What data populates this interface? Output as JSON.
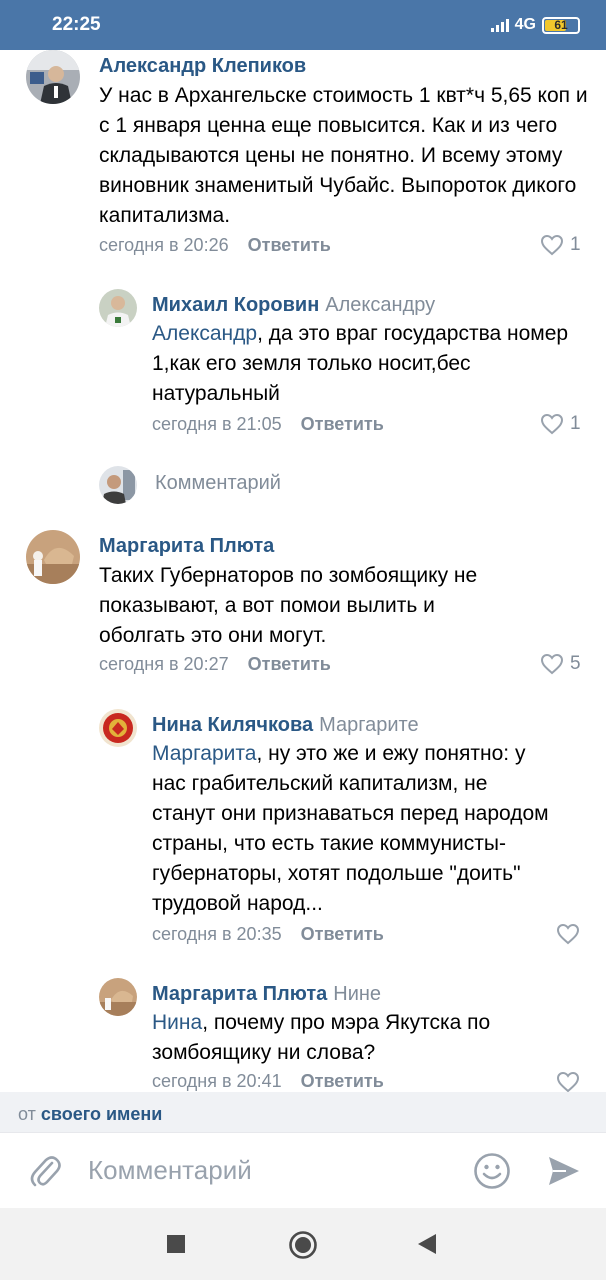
{
  "status_bar": {
    "time": "22:25",
    "network": "4G",
    "battery": "61",
    "battery_level": 0.61
  },
  "comments": [
    {
      "author": "Александр Клепиков",
      "reply_to": "",
      "mention": "",
      "text": "У нас в Архангельске стоимость 1 квт*ч 5,65 коп и с 1 января ценна еще повысится. Как и из чего складываются цены не понятно. И всему этому виновник знаменитый Чубайс. Выпороток дикого капитализма.",
      "date": "сегодня в 20:26",
      "reply_label": "Ответить",
      "likes": "1"
    },
    {
      "author": "Михаил Коровин",
      "reply_to": "Александру",
      "mention": "Александр",
      "text": ", да это враг государства номер 1,как его земля только носит,бес натуральный",
      "date": "сегодня в 21:05",
      "reply_label": "Ответить",
      "likes": "1"
    },
    {
      "author": "Маргарита Плюта",
      "reply_to": "",
      "mention": "",
      "text": "Таких Губернаторов по зомбоящику не показывают, а вот помои вылить и оболгать это они могут.",
      "date": "сегодня в 20:27",
      "reply_label": "Ответить",
      "likes": "5"
    },
    {
      "author": "Нина Килячкова",
      "reply_to": "Маргарите",
      "mention": "Маргарита",
      "text": ", ну это же и ежу понятно: у нас грабительский капитализм, не станут они признаваться перед народом страны, что есть такие коммунисты-губернаторы, хотят подольше \"доить\" трудовой народ...",
      "date": "сегодня в 20:35",
      "reply_label": "Ответить",
      "likes": ""
    },
    {
      "author": "Маргарита Плюта",
      "reply_to": "Нине",
      "mention": "Нина",
      "text": ", почему про мэра Якутска по зомбоящику ни слова?",
      "date": "сегодня в 20:41",
      "reply_label": "Ответить",
      "likes": ""
    }
  ],
  "inline_comment_placeholder": "Комментарий",
  "from_bar": {
    "prefix": "от",
    "name": "своего имени"
  },
  "composer": {
    "placeholder": "Комментарий"
  },
  "icons": {
    "attach": "paperclip-icon",
    "emoji": "smile-icon",
    "send": "send-icon",
    "like": "heart-icon",
    "nav": [
      "square-icon",
      "circle-icon",
      "back-triangle-icon"
    ]
  },
  "colors": {
    "header": "#4a76a8",
    "link": "#2a5885",
    "muted": "#818c99"
  }
}
